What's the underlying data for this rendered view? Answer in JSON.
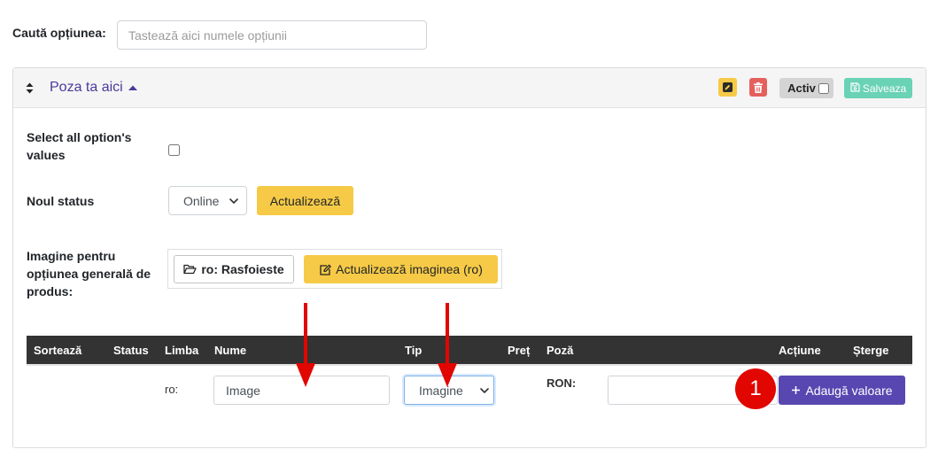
{
  "search": {
    "label": "Caută opțiunea:",
    "placeholder": "Tastează aici numele opțiunii"
  },
  "option_panel": {
    "title": "Poza ta aici",
    "active_label": "Activ",
    "active_checked": false,
    "save_label": "Salveaza"
  },
  "bulk_actions": {
    "select_all_label": "Select all option's values",
    "select_all_checked": false,
    "status_label": "Noul status",
    "status_value": "Online",
    "update_label": "Actualizează"
  },
  "general_image": {
    "label": "Imagine pentru opțiunea generală de produs:",
    "browse_label": "ro: Rasfoieste",
    "update_label": "Actualizează imaginea (ro)"
  },
  "values_table": {
    "headers": [
      "Sortează",
      "Status",
      "Limba",
      "Nume",
      "Tip",
      "Preț",
      "Poză",
      "Acțiune",
      "Șterge"
    ],
    "new_row": {
      "language": "ro:",
      "name_value": "Image",
      "type_value": "Imagine",
      "currency": "RON:",
      "price_value": "",
      "add_label": "Adaugă valoare"
    }
  },
  "annotation": {
    "marker_label": "1"
  },
  "icons": [
    "sort-icon",
    "caret-up-icon",
    "pencil-icon",
    "trash-icon",
    "save-icon",
    "chevron-down-icon",
    "folder-open-icon",
    "edit-icon",
    "plus-icon"
  ],
  "colors": {
    "primary_purple": "#5847b0",
    "title_purple": "#4a3a9c",
    "warning_yellow": "#f6ca46",
    "danger_red": "#e5605d",
    "success_green": "#6ad2b5",
    "table_header_dark": "#333333",
    "annotation_red": "#e10600"
  }
}
